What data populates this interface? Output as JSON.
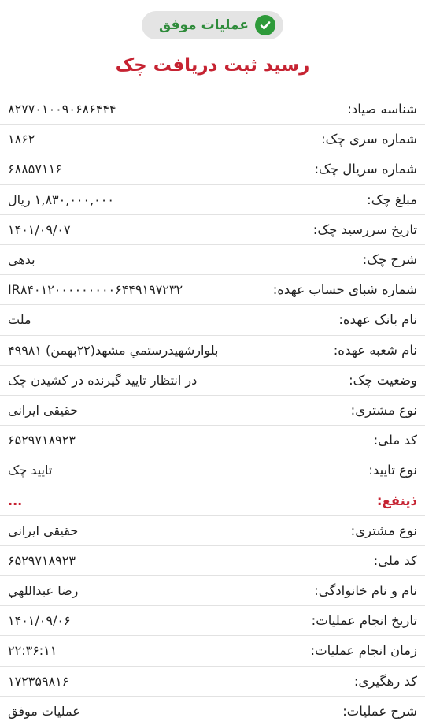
{
  "status_badge": {
    "label": "عملیات موفق",
    "accent_color": "#2e9a3a",
    "icon": "check-circle-icon"
  },
  "title": "رسید ثبت دریافت چک",
  "rows": [
    {
      "label": "شناسه صیاد:",
      "value": "۸۲۷۷۰۱۰۰۹۰۶۸۶۴۴۴"
    },
    {
      "label": "شماره سری چک:",
      "value": "۱۸۶۲"
    },
    {
      "label": "شماره سریال چک:",
      "value": "۶۸۸۵۷۱۱۶"
    },
    {
      "label": "مبلغ چک:",
      "value": "۱,۸۳۰,۰۰۰,۰۰۰ ریال"
    },
    {
      "label": "تاریخ سررسید چک:",
      "value": "۱۴۰۱/۰۹/۰۷"
    },
    {
      "label": "شرح چک:",
      "value": "بدهی"
    },
    {
      "label": "شماره شبای حساب عهده:",
      "value": "IR۸۴۰۱۲۰۰۰۰۰۰۰۰۰۶۴۴۹۱۹۷۲۳۲"
    },
    {
      "label": "نام بانک عهده:",
      "value": "ملت"
    },
    {
      "label": "نام شعبه عهده:",
      "value": "بلوارشهیدرستمي مشهد(۲۲بهمن) ۴۹۹۸۱"
    },
    {
      "label": "وضعیت چک:",
      "value": "در انتظار تایید گیرنده در کشیدن چک"
    },
    {
      "label": "نوع مشتری:",
      "value": "حقیقی ایرانی"
    },
    {
      "label": "کد ملی:",
      "value": "۶۵۲۹۷۱۸۹۲۳"
    },
    {
      "label": "نوع تایید:",
      "value": "تایید چک"
    },
    {
      "label": "ذینفع:",
      "value": "...",
      "section": true
    },
    {
      "label": "نوع مشتری:",
      "value": "حقیقی ایرانی"
    },
    {
      "label": "کد ملی:",
      "value": "۶۵۲۹۷۱۸۹۲۳"
    },
    {
      "label": "نام و نام خانوادگی:",
      "value": "رضا عبداللهي"
    },
    {
      "label": "تاریخ انجام عملیات:",
      "value": "۱۴۰۱/۰۹/۰۶"
    },
    {
      "label": "زمان انجام عملیات:",
      "value": "۲۲:۳۶:۱۱"
    },
    {
      "label": "کد رهگیری:",
      "value": "۱۷۲۳۵۹۸۱۶"
    },
    {
      "label": "شرح عملیات:",
      "value": "عملیات موفق"
    }
  ]
}
